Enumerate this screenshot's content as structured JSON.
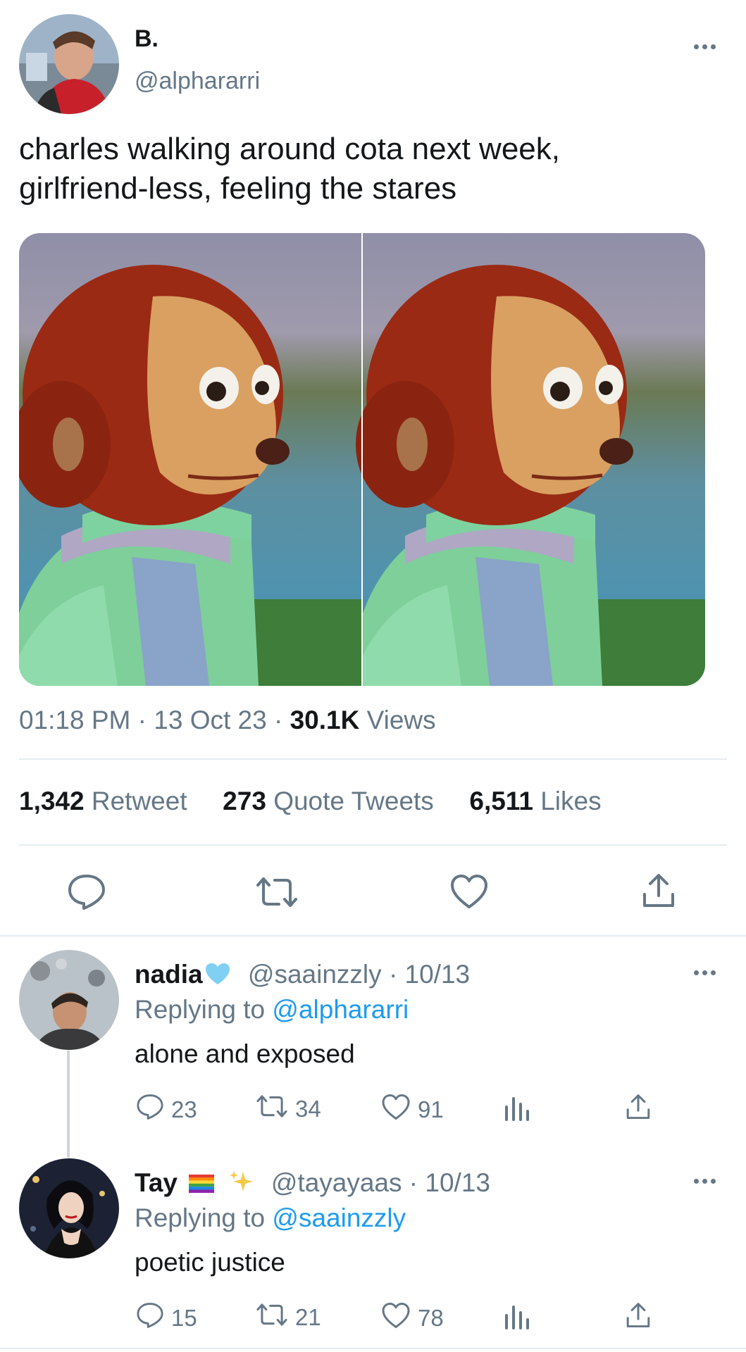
{
  "main_tweet": {
    "display_name": "B.",
    "handle": "@alphararri",
    "text_line1": "charles walking around cota next week,",
    "text_line2": "girlfriend-less, feeling the stares",
    "time": "01:18 PM",
    "date": "13 Oct 23",
    "views_count": "30.1K",
    "views_label": "Views",
    "separator": "·",
    "retweet_count": "1,342",
    "retweet_label": "Retweet",
    "quote_count": "273",
    "quote_label": "Quote Tweets",
    "like_count": "6,511",
    "like_label": "Likes"
  },
  "replies": [
    {
      "display_name": "nadia",
      "handle": "@saainzzly",
      "date": "· 10/13",
      "replying_prefix": "Replying to",
      "replying_to": "@alphararri",
      "text": "alone and exposed",
      "reply_count": "23",
      "retweet_count": "34",
      "like_count": "91"
    },
    {
      "display_name": "Tay",
      "handle": "@tayayaas",
      "date": "· 10/13",
      "replying_prefix": "Replying to",
      "replying_to": "@saainzzly",
      "text": "poetic justice",
      "reply_count": "15",
      "retweet_count": "21",
      "like_count": "78"
    }
  ],
  "colors": {
    "link_blue": "#1d9bf0",
    "muted_gray": "#657786",
    "divider": "#e6ecf0"
  }
}
